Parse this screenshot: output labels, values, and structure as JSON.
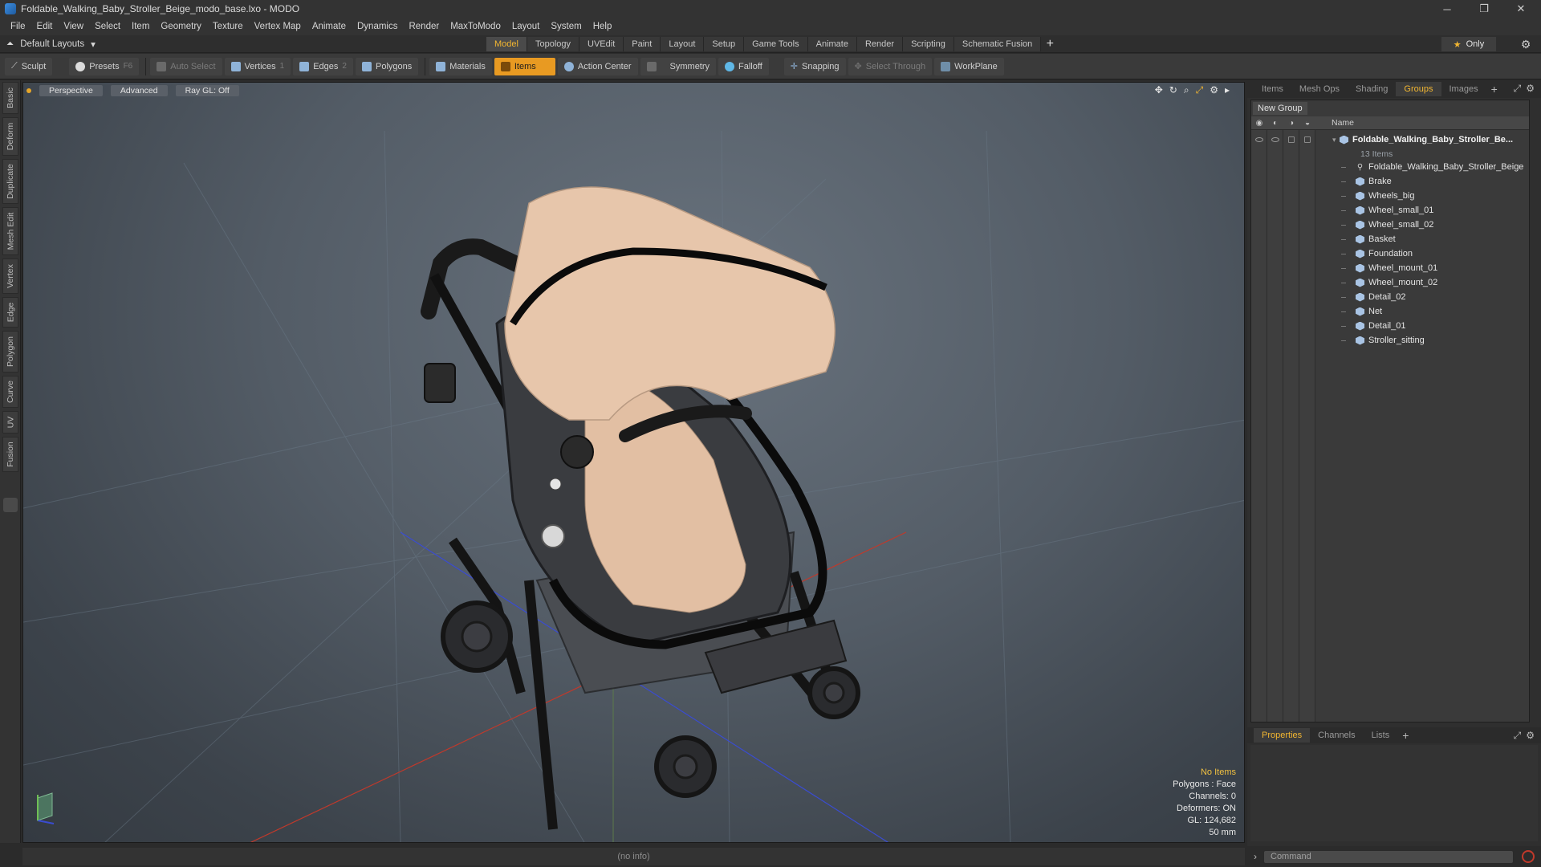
{
  "window": {
    "title": "Foldable_Walking_Baby_Stroller_Beige_modo_base.lxo - MODO",
    "controls": {
      "minimize": "─",
      "restore": "❐",
      "close": "✕"
    }
  },
  "menu": [
    "File",
    "Edit",
    "View",
    "Select",
    "Item",
    "Geometry",
    "Texture",
    "Vertex Map",
    "Animate",
    "Dynamics",
    "Render",
    "MaxToModo",
    "Layout",
    "System",
    "Help"
  ],
  "layout_bar": {
    "layouts_label": "Default Layouts",
    "tabs": [
      "Model",
      "Topology",
      "UVEdit",
      "Paint",
      "Layout",
      "Setup",
      "Game Tools",
      "Animate",
      "Render",
      "Scripting",
      "Schematic Fusion"
    ],
    "active_tab": "Model",
    "only_label": "Only"
  },
  "toolbar": {
    "sculpt": "Sculpt",
    "presets": "Presets",
    "presets_key": "F6",
    "auto_select": "Auto Select",
    "vertices": "Vertices",
    "vertices_key": "1",
    "edges": "Edges",
    "edges_key": "2",
    "polygons": "Polygons",
    "materials": "Materials",
    "items": "Items",
    "action_center": "Action Center",
    "symmetry": "Symmetry",
    "falloff": "Falloff",
    "snapping": "Snapping",
    "select_through": "Select Through",
    "workplane": "WorkPlane"
  },
  "left_tabs": [
    "Basic",
    "Deform",
    "Duplicate",
    "Mesh Edit",
    "Vertex",
    "Edge",
    "Polygon",
    "Curve",
    "UV",
    "Fusion"
  ],
  "viewport": {
    "view_mode": "Perspective",
    "shading": "Advanced",
    "raygl": "Ray GL: Off",
    "info": {
      "selection": "No Items",
      "polygons": "Polygons : Face",
      "channels": "Channels: 0",
      "deformers": "Deformers: ON",
      "gl": "GL: 124,682",
      "focal": "50 mm"
    }
  },
  "status_bar": "(no info)",
  "right_panel": {
    "tabs": [
      "Items",
      "Mesh Ops",
      "Shading",
      "Groups",
      "Images"
    ],
    "active_tab": "Groups",
    "new_group": "New Group",
    "column_name": "Name",
    "group": {
      "name": "Foldable_Walking_Baby_Stroller_Be...",
      "count": "13 Items",
      "items": [
        {
          "name": "Foldable_Walking_Baby_Stroller_Beige",
          "icon": "locator-icon"
        },
        {
          "name": "Brake",
          "icon": "mesh-icon"
        },
        {
          "name": "Wheels_big",
          "icon": "mesh-icon"
        },
        {
          "name": "Wheel_small_01",
          "icon": "mesh-icon"
        },
        {
          "name": "Wheel_small_02",
          "icon": "mesh-icon"
        },
        {
          "name": "Basket",
          "icon": "mesh-icon"
        },
        {
          "name": "Foundation",
          "icon": "mesh-icon"
        },
        {
          "name": "Wheel_mount_01",
          "icon": "mesh-icon"
        },
        {
          "name": "Wheel_mount_02",
          "icon": "mesh-icon"
        },
        {
          "name": "Detail_02",
          "icon": "mesh-icon"
        },
        {
          "name": "Net",
          "icon": "mesh-icon"
        },
        {
          "name": "Detail_01",
          "icon": "mesh-icon"
        },
        {
          "name": "Stroller_sitting",
          "icon": "mesh-icon"
        }
      ]
    },
    "bottom_tabs": [
      "Properties",
      "Channels",
      "Lists"
    ],
    "bottom_active": "Properties",
    "command_placeholder": "Command"
  }
}
